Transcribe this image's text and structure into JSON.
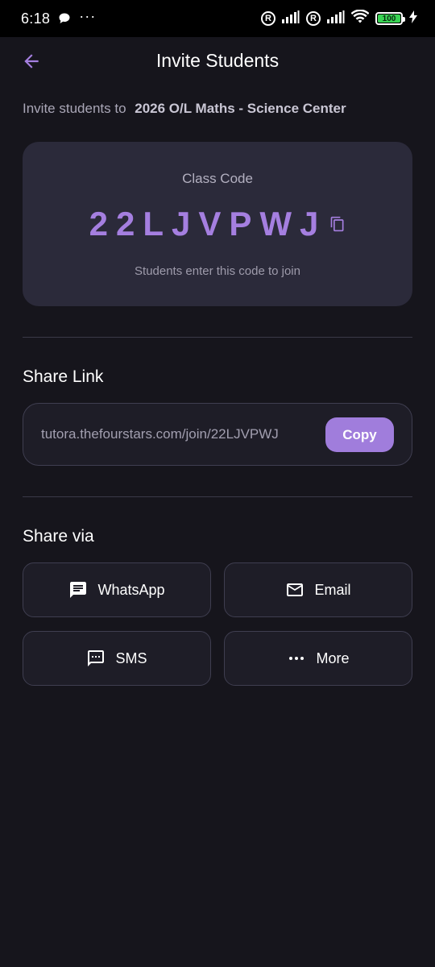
{
  "status_bar": {
    "time": "6:18",
    "dots": "···",
    "reg_symbol": "R",
    "battery_level": "100",
    "battery_fraction": 1.0
  },
  "header": {
    "title": "Invite Students"
  },
  "invite": {
    "prefix": "Invite students to",
    "class_name": "2026 O/L Maths - Science Center"
  },
  "class_code": {
    "label": "Class Code",
    "value": "22LJVPWJ",
    "hint": "Students enter this code to join"
  },
  "share_link": {
    "title": "Share Link",
    "url": "tutora.thefourstars.com/join/22LJVPWJ",
    "copy_label": "Copy"
  },
  "share_via": {
    "title": "Share via",
    "options": [
      {
        "label": "WhatsApp",
        "icon": "message-icon"
      },
      {
        "label": "Email",
        "icon": "mail-icon"
      },
      {
        "label": "SMS",
        "icon": "sms-icon"
      },
      {
        "label": "More",
        "icon": "more-icon"
      }
    ]
  },
  "colors": {
    "background": "#16151c",
    "card": "#2b2a3a",
    "accent": "#a57fe0",
    "button": "#a07ddc",
    "battery": "#39d353"
  }
}
